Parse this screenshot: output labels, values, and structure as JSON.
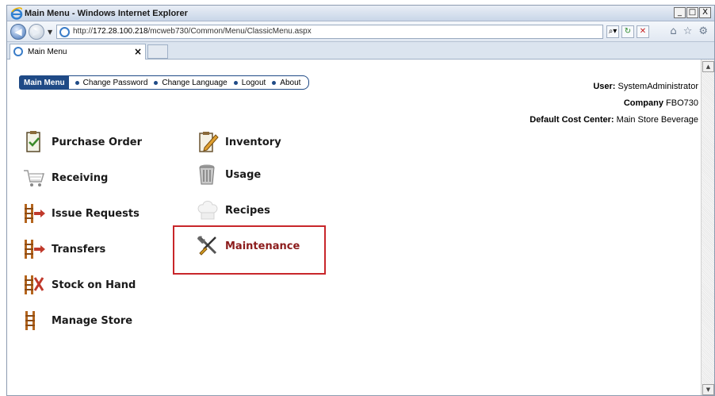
{
  "window": {
    "title": "Main Menu - Windows Internet Explorer",
    "controls": {
      "minimize": "_",
      "maximize": "□",
      "close": "X"
    }
  },
  "address": {
    "url_prefix": "http://",
    "url_host": "172.28.100.218",
    "url_path": "/mcweb730/Common/Menu/ClassicMenu.aspx"
  },
  "tab": {
    "label": "Main Menu",
    "close": "×"
  },
  "menubar": {
    "main_menu": "Main Menu",
    "links": [
      "Change Password",
      "Change Language",
      "Logout",
      "About"
    ]
  },
  "user": {
    "user_label": "User:",
    "user_value": "SystemAdministrator",
    "company_label": "Company",
    "company_value": "FBO730",
    "cost_center_label": "Default Cost Center:",
    "cost_center_value": "Main Store Beverage"
  },
  "modules_left": [
    {
      "label": "Purchase Order",
      "icon": "clipboard-check-icon"
    },
    {
      "label": "Receiving",
      "icon": "shopping-cart-icon"
    },
    {
      "label": "Issue Requests",
      "icon": "ladder-arrow-icon"
    },
    {
      "label": "Transfers",
      "icon": "ladder-arrow-icon"
    },
    {
      "label": "Stock on Hand",
      "icon": "ladder-cross-icon"
    },
    {
      "label": "Manage Store",
      "icon": "ladder-icon"
    }
  ],
  "modules_right": [
    {
      "label": "Inventory",
      "icon": "clipboard-pencil-icon"
    },
    {
      "label": "Usage",
      "icon": "trash-can-icon"
    },
    {
      "label": "Recipes",
      "icon": "chef-hat-icon"
    },
    {
      "label": "Maintenance",
      "icon": "wrench-screwdriver-icon"
    }
  ],
  "colors": {
    "menu_blue": "#1f4a86",
    "highlight_red": "#c8262a",
    "maintenance_text": "#8c1c1c"
  }
}
